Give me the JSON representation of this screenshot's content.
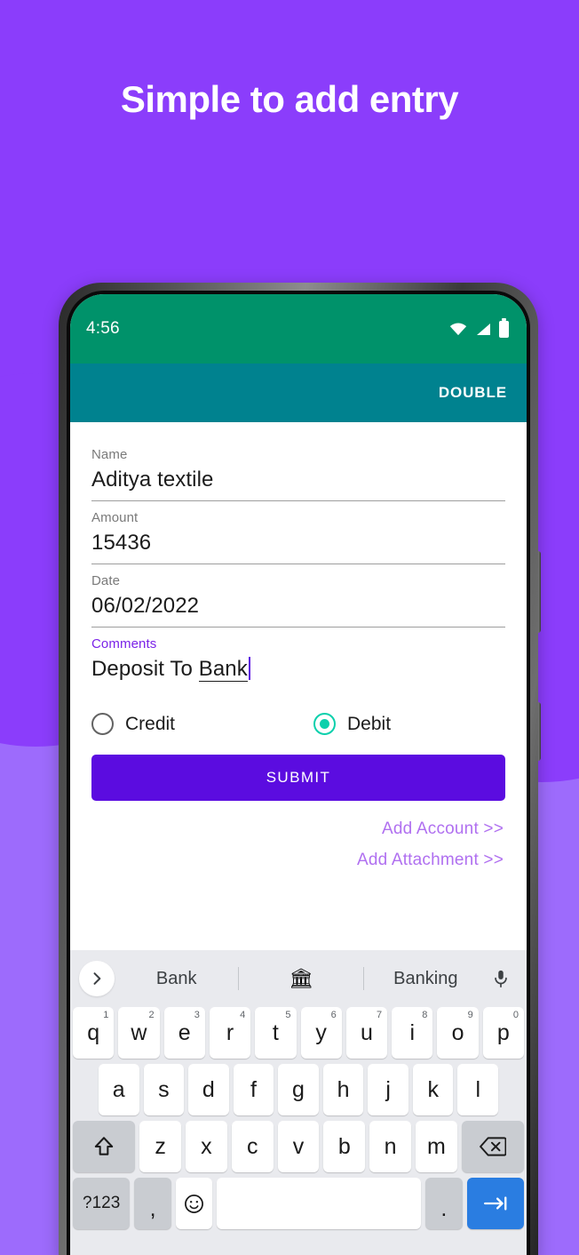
{
  "promo": {
    "headline": "Simple to add entry",
    "bg_color": "#8b3dfb",
    "bg_color_light": "#9d6bfc"
  },
  "phone": {
    "status_bar": {
      "time": "4:56",
      "bg_color": "#00926a",
      "icons": [
        "wifi-icon",
        "signal-icon",
        "battery-icon"
      ]
    },
    "app_bar": {
      "title": "DOUBLE",
      "bg_color": "#00828f"
    }
  },
  "form": {
    "fields": [
      {
        "label": "Name",
        "value": "Aditya textile",
        "active": false
      },
      {
        "label": "Amount",
        "value": "15436",
        "active": false
      },
      {
        "label": "Date",
        "value": "06/02/2022",
        "active": false
      }
    ],
    "comments": {
      "label": "Comments",
      "value_plain": "Deposit To ",
      "value_spellcheck": "Bank",
      "active": true,
      "accent_color": "#7b24e8"
    },
    "radios": [
      {
        "label": "Credit",
        "selected": false
      },
      {
        "label": "Debit",
        "selected": true
      }
    ],
    "radio_selected_color": "#0ad0ac",
    "submit_label": "SUBMIT",
    "submit_color": "#5b0ce0",
    "links": [
      {
        "label": "Add Account >>"
      },
      {
        "label": "Add Attachment >>"
      }
    ],
    "link_color": "#b070f0"
  },
  "keyboard": {
    "suggestions": {
      "expand_icon": "chevron-right-icon",
      "word_1": "Bank",
      "emoji": "🏛",
      "word_2": "Banking",
      "mic_icon": "microphone-icon"
    },
    "row1": [
      {
        "key": "q",
        "num": "1"
      },
      {
        "key": "w",
        "num": "2"
      },
      {
        "key": "e",
        "num": "3"
      },
      {
        "key": "r",
        "num": "4"
      },
      {
        "key": "t",
        "num": "5"
      },
      {
        "key": "y",
        "num": "6"
      },
      {
        "key": "u",
        "num": "7"
      },
      {
        "key": "i",
        "num": "8"
      },
      {
        "key": "o",
        "num": "9"
      },
      {
        "key": "p",
        "num": "0"
      }
    ],
    "row2": [
      {
        "key": "a"
      },
      {
        "key": "s"
      },
      {
        "key": "d"
      },
      {
        "key": "f"
      },
      {
        "key": "g"
      },
      {
        "key": "h"
      },
      {
        "key": "j"
      },
      {
        "key": "k"
      },
      {
        "key": "l"
      }
    ],
    "row3_letters": [
      {
        "key": "z"
      },
      {
        "key": "x"
      },
      {
        "key": "c"
      },
      {
        "key": "v"
      },
      {
        "key": "b"
      },
      {
        "key": "n"
      },
      {
        "key": "m"
      }
    ],
    "shift_icon": "shift-icon",
    "backspace_icon": "backspace-icon",
    "row4": {
      "symbols_label": "?123",
      "comma_label": ",",
      "emoji_icon": "emoji-smiley-icon",
      "space_label": "",
      "period_label": ".",
      "enter_icon": "tab-next-icon",
      "enter_color": "#2a7de1"
    }
  }
}
